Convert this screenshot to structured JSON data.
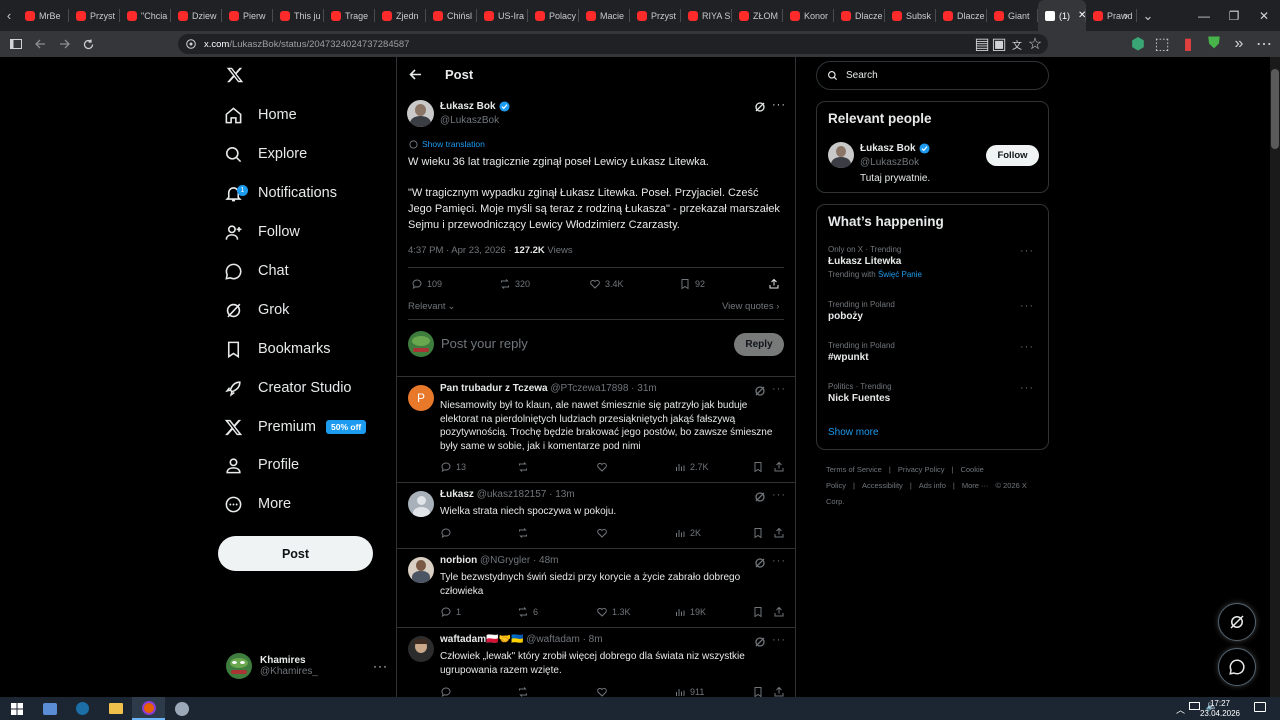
{
  "browser": {
    "tabs": [
      "MrBe",
      "Przyst",
      "\"Chcia",
      "Dziew",
      "Pierw",
      "This ju",
      "Trage",
      "Zjedn",
      "Chińsl",
      "US-Ira",
      "Polacy",
      "Macie",
      "Przyst",
      "RIYA S",
      "ZŁOM",
      "Konor",
      "Dlacze",
      "Subsk",
      "Dlacze",
      "Giant"
    ],
    "active_tab": "(1)",
    "next_tab": "Prawd",
    "url_domain": "x.com",
    "url_path": "/LukaszBok/status/2047324024737284587"
  },
  "nav": {
    "items": [
      "Home",
      "Explore",
      "Notifications",
      "Follow",
      "Chat",
      "Grok",
      "Bookmarks",
      "Creator Studio",
      "Premium",
      "Profile",
      "More"
    ],
    "notif_count": "1",
    "premium_badge": "50% off",
    "post_button": "Post",
    "account_name": "Khamires",
    "account_handle": "@Khamires_"
  },
  "main": {
    "header": "Post",
    "author": {
      "name": "Łukasz Bok",
      "handle": "@LukaszBok"
    },
    "show_translation": "Show translation",
    "text_1": "W wieku 36 lat tragicznie zginął poseł Lewicy Łukasz Litewka.",
    "text_2": "\"W tragicznym wypadku zginął Łukasz Litewka. Poseł. Przyjaciel. Cześć Jego Pamięci. Moje myśli są teraz z rodziną Łukasza\" - przekazał marszałek Sejmu i przewodniczący Lewicy Włodzimierz Czarzasty.",
    "time": "4:37 PM · Apr 23, 2026 · ",
    "views": "127.2K",
    "views_label": " Views",
    "stats": {
      "replies": "109",
      "reposts": "320",
      "likes": "3.4K",
      "bookmarks": "92"
    },
    "relevant": "Relevant",
    "view_quotes": "View quotes",
    "reply_placeholder": "Post your reply",
    "reply_button": "Reply"
  },
  "replies": [
    {
      "name": "Pan trubadur z Tczewa",
      "handle": "@PTczewa17898",
      "time": "· 31m",
      "text": "Niesamowity był to klaun, ale nawet śmiesznie się patrzyło jak buduje elektorat na pierdolniętych ludziach przesiąkniętych jakąś fałszywą pozytywnością. Trochę będzie brakować jego postów, bo zawsze śmieszne były same w sobie, jak i komentarze pod nimi",
      "replies": "13",
      "reposts": "",
      "likes": "",
      "views": "2.7K"
    },
    {
      "name": "Łukasz",
      "handle": "@ukasz182157",
      "time": "· 13m",
      "text": "Wielka strata niech spoczywa w pokoju.",
      "replies": "",
      "reposts": "",
      "likes": "",
      "views": "2K"
    },
    {
      "name": "norbion",
      "handle": "@NGrygler",
      "time": "· 48m",
      "text": "Tyle bezwstydnych świń siedzi przy korycie a życie zabrało dobrego człowieka",
      "replies": "1",
      "reposts": "6",
      "likes": "1.3K",
      "views": "19K"
    },
    {
      "name": "waftadam🇵🇱🤝🇺🇦",
      "handle": "@waftadam",
      "time": "· 8m",
      "text": "Człowiek „lewak\" który zrobił więcej dobrego dla świata niz wszystkie ugrupowania razem wzięte.",
      "replies": "",
      "reposts": "",
      "likes": "",
      "views": "911"
    }
  ],
  "right": {
    "search_placeholder": "Search",
    "relevant_title": "Relevant people",
    "person_name": "Łukasz Bok",
    "person_handle": "@LukaszBok",
    "person_bio": "Tutaj prywatnie.",
    "follow_button": "Follow",
    "happening_title": "What’s happening",
    "trends": [
      {
        "meta": "Only on X · Trending",
        "name": "Łukasz Litewka",
        "with_label": "Trending with ",
        "with_link": "Święć Panie"
      },
      {
        "meta": "Trending in Poland",
        "name": "poboży"
      },
      {
        "meta": "Trending in Poland",
        "name": "#wpunkt"
      },
      {
        "meta": "Politics · Trending",
        "name": "Nick Fuentes"
      }
    ],
    "show_more": "Show more",
    "footer": [
      "Terms of Service",
      "|",
      "Privacy Policy",
      "|",
      "Cookie Policy",
      "|",
      "Accessibility",
      "|",
      "Ads info",
      "|",
      "More ···",
      "© 2026 X Corp."
    ]
  },
  "taskbar": {
    "time": "17:27",
    "date": "23.04.2026"
  },
  "colors": {
    "accent": "#1d9bf0",
    "background": "#000000",
    "border": "#2f3336",
    "muted": "#71767b"
  }
}
